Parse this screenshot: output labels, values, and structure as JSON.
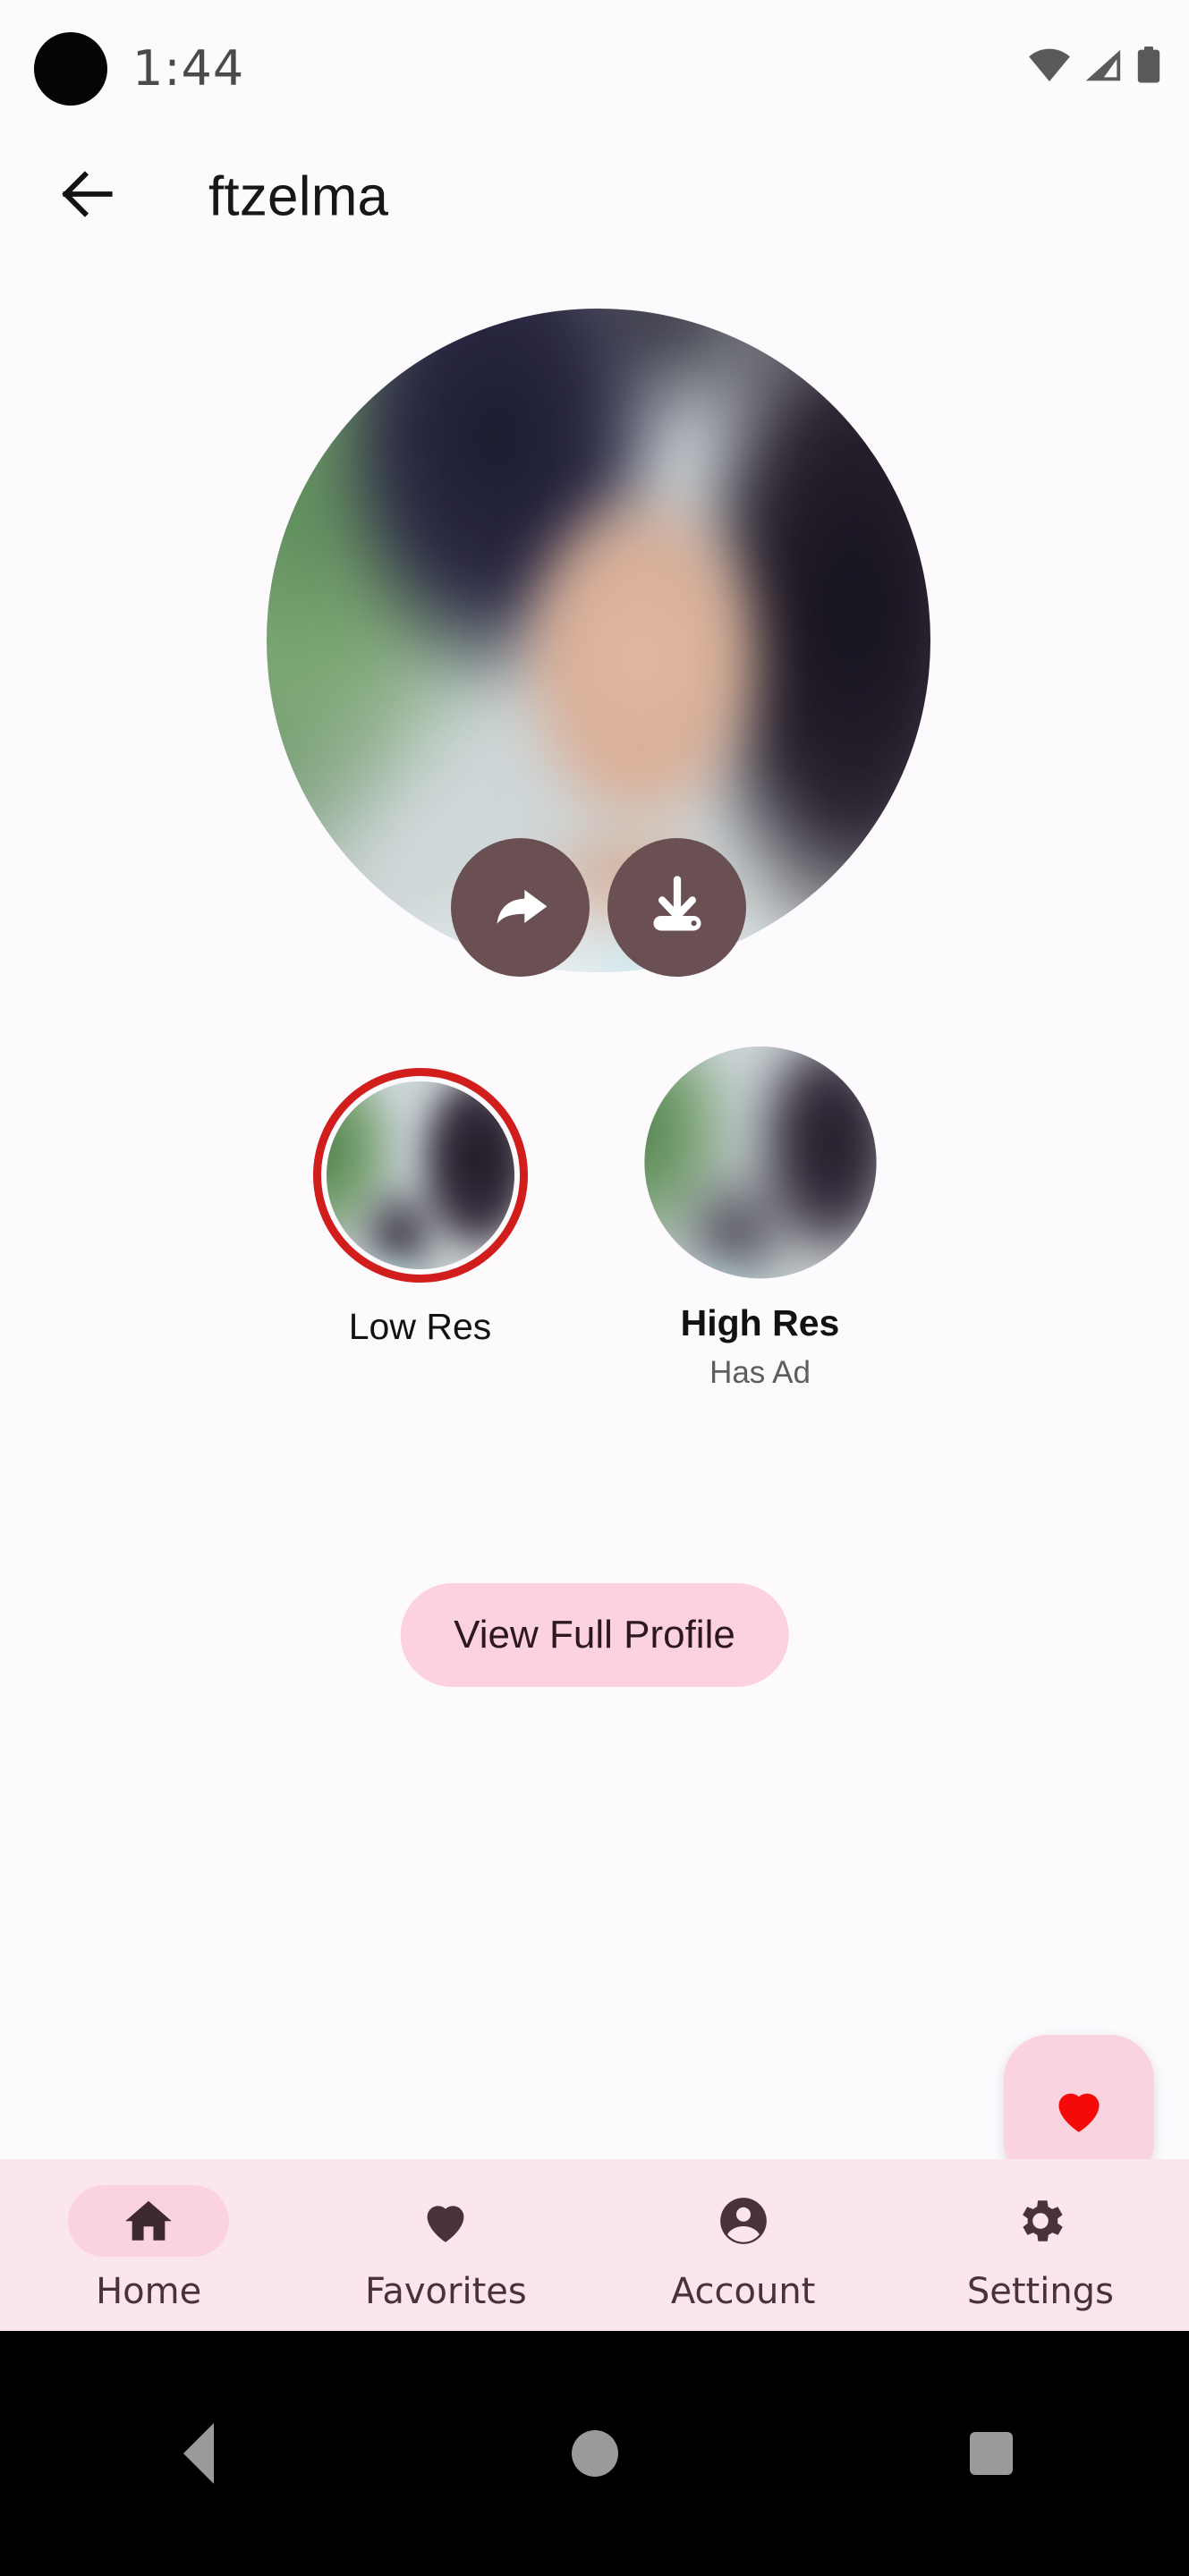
{
  "status_bar": {
    "time": "1:44",
    "icons": [
      "wifi-icon",
      "cellular-signal-icon",
      "battery-icon"
    ]
  },
  "app_bar": {
    "back_icon": "arrow-back-icon",
    "title": "ftzelma"
  },
  "avatar": {
    "name": "profile-avatar",
    "description": "blurred profile photo",
    "actions": [
      {
        "name": "share-button",
        "icon": "share-arrow-icon"
      },
      {
        "name": "download-button",
        "icon": "download-icon"
      }
    ]
  },
  "resolution_options": [
    {
      "label": "Low Res",
      "subtitle": "",
      "selected": true,
      "ring_color": "#D21D1D"
    },
    {
      "label": "High Res",
      "subtitle": "Has Ad",
      "selected": false,
      "ring_color": ""
    }
  ],
  "profile_button": {
    "label": "View Full Profile"
  },
  "fab": {
    "name": "favorite-fab",
    "icon": "heart-icon",
    "color": "#FBD3DE",
    "icon_color": "#F50A0A"
  },
  "bottom_nav": {
    "background": "#FAE6EC",
    "active_pill": "#FBD3DE",
    "items": [
      {
        "label": "Home",
        "icon": "home-icon",
        "active": true
      },
      {
        "label": "Favorites",
        "icon": "heart-icon",
        "active": false
      },
      {
        "label": "Account",
        "icon": "account-circle-icon",
        "active": false
      },
      {
        "label": "Settings",
        "icon": "gear-icon",
        "active": false
      }
    ]
  },
  "system_nav": {
    "items": [
      {
        "name": "system-back-button",
        "icon": "triangle-back-icon"
      },
      {
        "name": "system-home-button",
        "icon": "circle-home-icon"
      },
      {
        "name": "system-recents-button",
        "icon": "square-recents-icon"
      }
    ]
  },
  "colors": {
    "page_background": "#FCFAFD",
    "accent_pink": "#FBD2DE",
    "action_circle": "#6B5053",
    "text_dark": "#121212"
  }
}
